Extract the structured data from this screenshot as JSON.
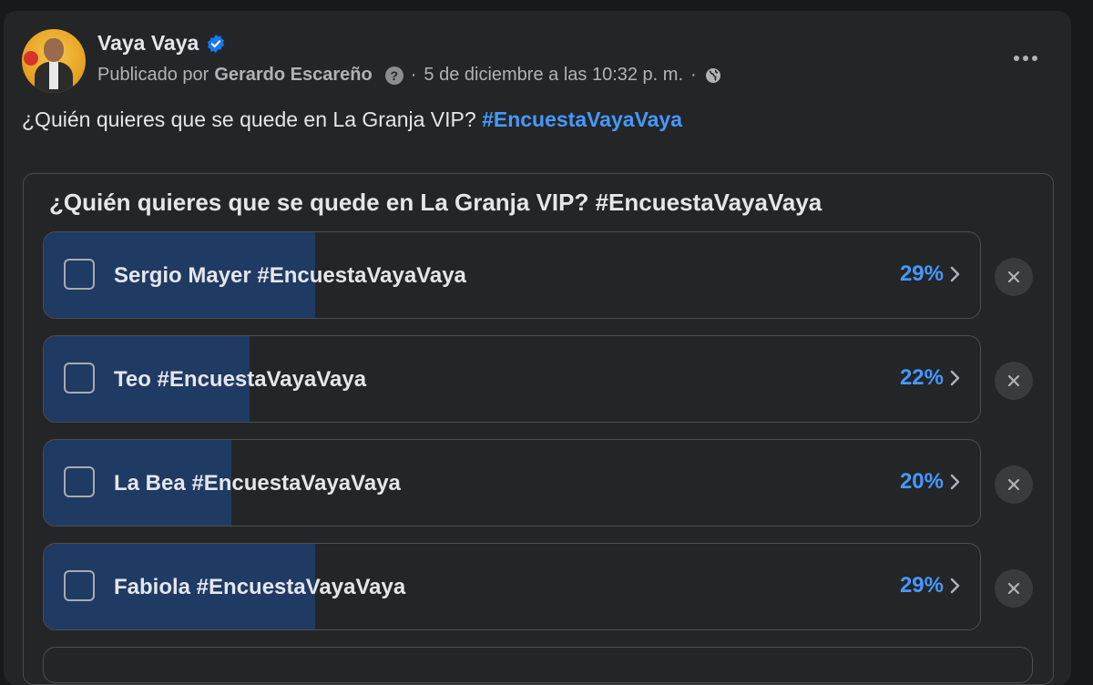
{
  "post": {
    "page_name": "Vaya Vaya",
    "published_by_label": "Publicado por",
    "author": "Gerardo Escareño",
    "help_mark": "?",
    "separator": "·",
    "timestamp": "5 de diciembre a las 10:32 p. m.",
    "text": "¿Quién quieres que se quede en La Granja VIP?",
    "hashtag": "#EncuestaVayaVaya"
  },
  "poll": {
    "question": "¿Quién quieres que se quede en La Granja VIP? #EncuestaVayaVaya",
    "options": [
      {
        "label": "Sergio Mayer #EncuestaVayaVaya",
        "percent_text": "29%",
        "fill_fraction": 0.29
      },
      {
        "label": "Teo #EncuestaVayaVaya",
        "percent_text": "22%",
        "fill_fraction": 0.22
      },
      {
        "label": "La Bea #EncuestaVayaVaya",
        "percent_text": "20%",
        "fill_fraction": 0.2
      },
      {
        "label": "Fabiola #EncuestaVayaVaya",
        "percent_text": "29%",
        "fill_fraction": 0.29
      }
    ]
  },
  "colors": {
    "background": "#18191a",
    "card": "#242526",
    "text_primary": "#e4e6eb",
    "text_secondary": "#b0b3b8",
    "accent_blue": "#4599ff",
    "poll_fill": "#1f3a63",
    "verified_badge": "#1877f2"
  },
  "icons": {
    "verified": "verified-badge-icon",
    "globe": "globe-icon",
    "more": "more-options-icon",
    "chevron": "chevron-right-icon",
    "close": "close-icon",
    "checkbox": "checkbox-icon"
  }
}
